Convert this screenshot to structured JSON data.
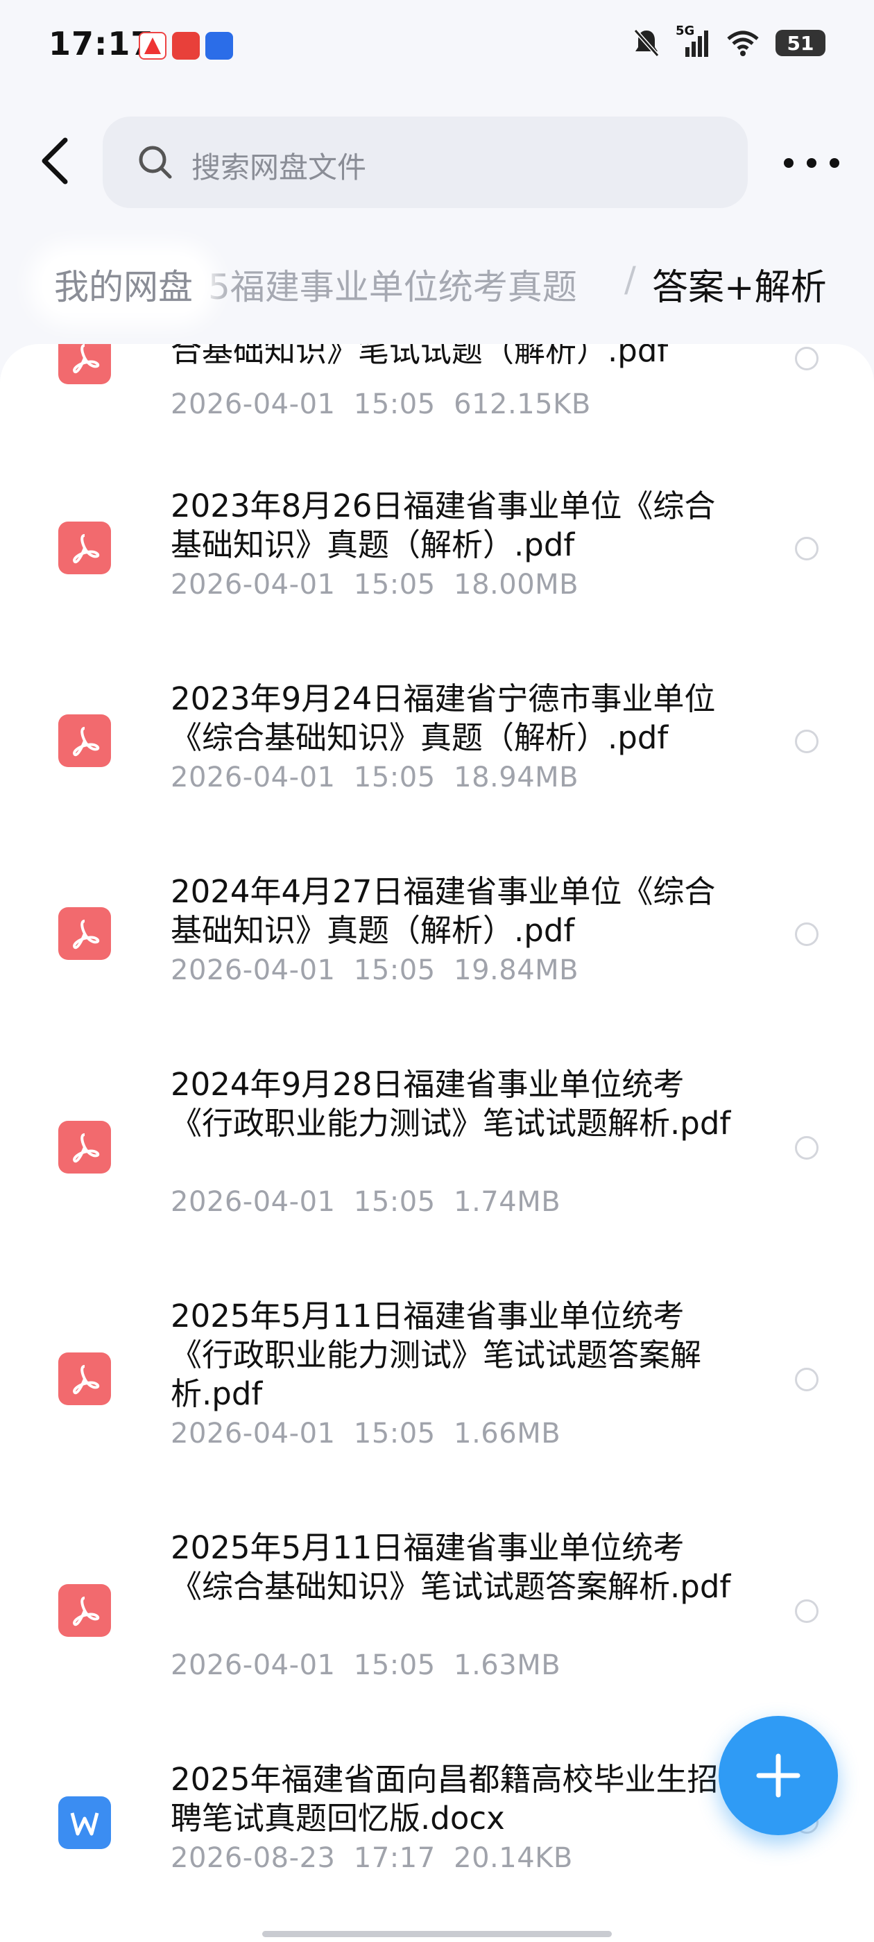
{
  "status_bar": {
    "time": "17:17",
    "network": "5G",
    "battery": "51",
    "icons": [
      "app-badge-icon",
      "red-app-icon",
      "blue-app-icon",
      "mute-icon",
      "signal-icon",
      "wifi-icon",
      "battery-icon"
    ]
  },
  "header": {
    "search_placeholder": "搜索网盘文件"
  },
  "breadcrumb": {
    "root": "我的网盘",
    "middle": "5福建事业单位统考真题",
    "separator": "/",
    "current": "答案+解析"
  },
  "files": [
    {
      "type": "pdf",
      "name": "合基础知识》笔试试题（解析）.pdf",
      "date": "2026-04-01",
      "time": "15:05",
      "size": "612.15KB"
    },
    {
      "type": "pdf",
      "name": "2023年8月26日福建省事业单位《综合基础知识》真题（解析）.pdf",
      "date": "2026-04-01",
      "time": "15:05",
      "size": "18.00MB"
    },
    {
      "type": "pdf",
      "name": "2023年9月24日福建省宁德市事业单位《综合基础知识》真题（解析）.pdf",
      "date": "2026-04-01",
      "time": "15:05",
      "size": "18.94MB"
    },
    {
      "type": "pdf",
      "name": "2024年4月27日福建省事业单位《综合基础知识》真题（解析）.pdf",
      "date": "2026-04-01",
      "time": "15:05",
      "size": "19.84MB"
    },
    {
      "type": "pdf",
      "name": "2024年9月28日福建省事业单位统考《行政职业能力测试》笔试试题解析.pdf",
      "date": "2026-04-01",
      "time": "15:05",
      "size": "1.74MB"
    },
    {
      "type": "pdf",
      "name": "2025年5月11日福建省事业单位统考《行政职业能力测试》笔试试题答案解析.pdf",
      "date": "2026-04-01",
      "time": "15:05",
      "size": "1.66MB"
    },
    {
      "type": "pdf",
      "name": "2025年5月11日福建省事业单位统考《综合基础知识》笔试试题答案解析.pdf",
      "date": "2026-04-01",
      "time": "15:05",
      "size": "1.63MB"
    },
    {
      "type": "docx",
      "name": "2025年福建省面向昌都籍高校毕业生招聘笔试真题回忆版.docx",
      "date": "2026-08-23",
      "time": "17:17",
      "size": "20.14KB"
    }
  ],
  "colors": {
    "pdf_icon": "#f26a6e",
    "docx_icon": "#3b8df2",
    "fab": "#2f9bf5",
    "meta_text": "#a0a3ab"
  }
}
